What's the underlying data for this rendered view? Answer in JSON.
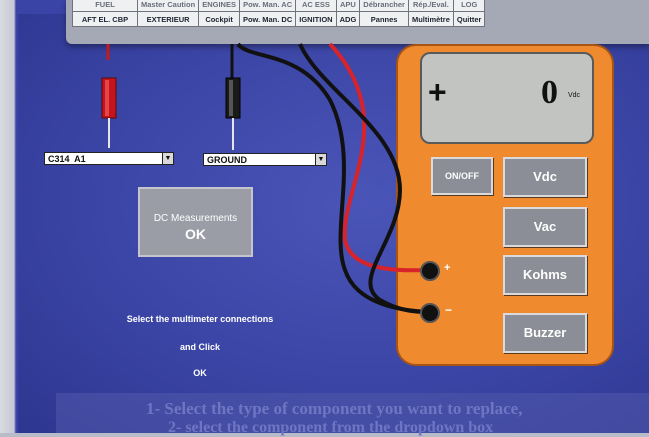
{
  "menu": {
    "row1": [
      "FUEL",
      "Master Caution",
      "ENGINES",
      "Pow. Man. AC",
      "AC ESS",
      "APU",
      "Débrancher",
      "Rép./Eval.",
      "LOG"
    ],
    "row2": [
      "AFT EL. CBP",
      "EXTERIEUR",
      "Cockpit",
      "Pow. Man. DC",
      "IGNITION",
      "ADG",
      "Pannes",
      "Multimètre",
      "Quitter"
    ]
  },
  "connections": {
    "left_select": "C314  A1",
    "right_select": "GROUND",
    "arrow_glyph": "▼"
  },
  "dc_button": {
    "line1": "DC Measurements",
    "line2": "OK"
  },
  "instructions": {
    "line1": "Select the multimeter connections",
    "line2": "and Click",
    "line3": "OK"
  },
  "multimeter": {
    "sign": "+",
    "value": "0",
    "unit": "Vdc",
    "buttons": {
      "onoff": "ON/OFF",
      "vdc": "Vdc",
      "vac": "Vac",
      "kohms": "Kohms",
      "buzzer": "Buzzer"
    },
    "terminal_plus": "+",
    "terminal_minus": "−"
  },
  "bottom_help": {
    "line1": "1- Select the type of component you want to replace,",
    "line2": "2- select the component from the dropdown box"
  }
}
